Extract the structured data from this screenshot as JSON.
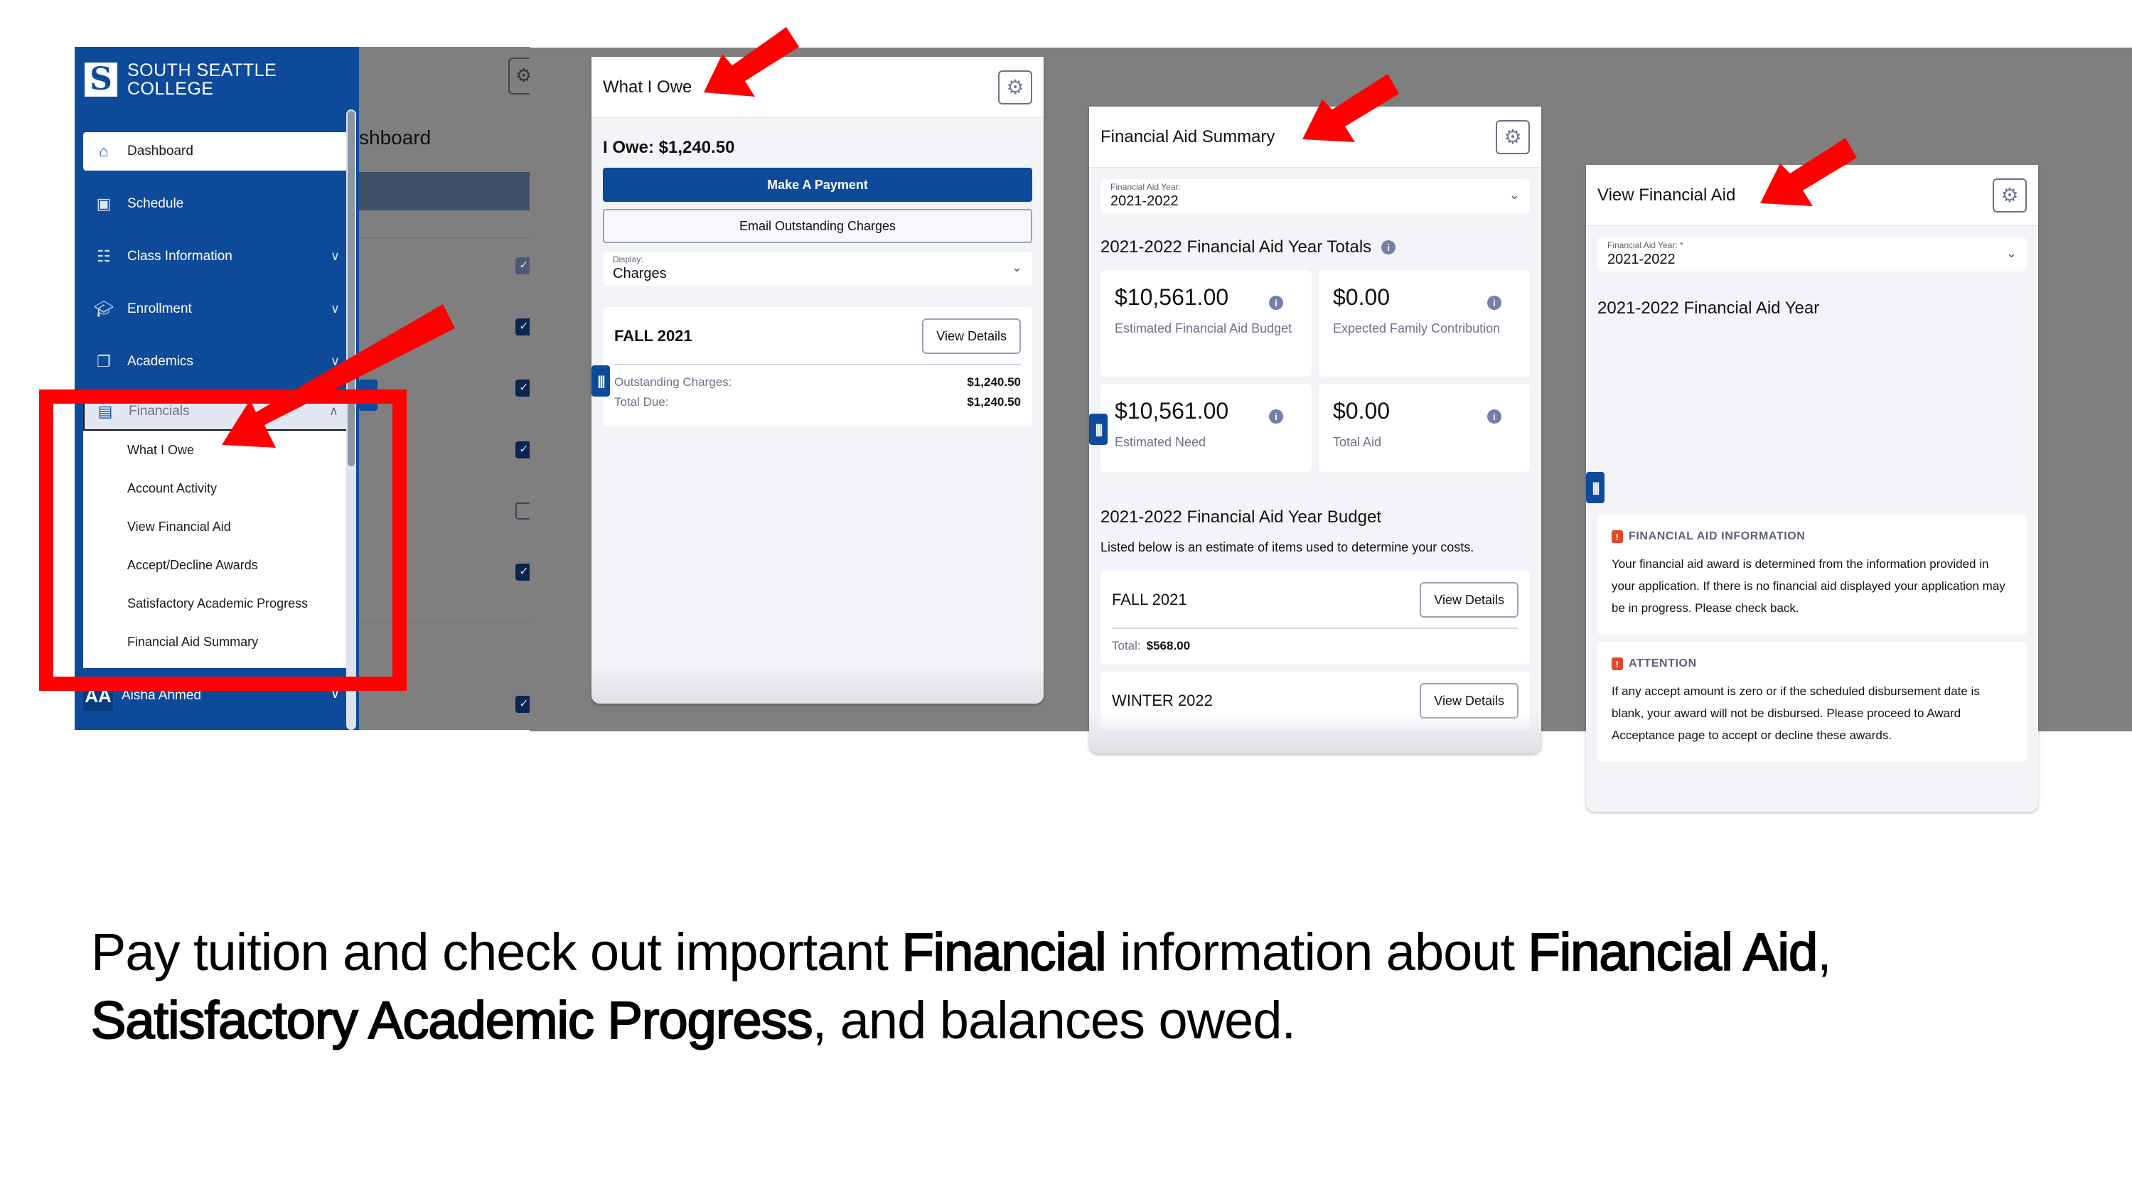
{
  "sidebar": {
    "logo_mark": "S",
    "logo_line1": "SOUTH SEATTLE",
    "logo_line2": "COLLEGE",
    "items": [
      {
        "label": "Dashboard",
        "icon": "home-icon",
        "active": true
      },
      {
        "label": "Schedule",
        "icon": "calendar-icon"
      },
      {
        "label": "Class Information",
        "icon": "list-icon",
        "expandable": true
      },
      {
        "label": "Enrollment",
        "icon": "graduation-cap-icon",
        "expandable": true
      },
      {
        "label": "Academics",
        "icon": "document-icon",
        "expandable": true
      }
    ],
    "financials": {
      "label": "Financials",
      "icon": "credit-card-icon",
      "expanded": true,
      "subitems": [
        "What I Owe",
        "Account Activity",
        "View Financial Aid",
        "Accept/Decline Awards",
        "Satisfactory Academic Progress",
        "Financial Aid Summary"
      ]
    },
    "user": {
      "initials": "AA",
      "name": "Aisha Ahmed"
    }
  },
  "dashboard_bg": {
    "title_fragment": "shboard",
    "checkboxes": [
      "checked-dim",
      "checked",
      "checked",
      "checked",
      "unchecked",
      "checked",
      "checked"
    ]
  },
  "what_i_owe": {
    "title": "What I Owe",
    "owe_label": "I Owe: $1,240.50",
    "make_payment": "Make A Payment",
    "email_charges": "Email Outstanding Charges",
    "display_label": "Display:",
    "display_value": "Charges",
    "term": "FALL 2021",
    "view_details": "View Details",
    "rows": [
      {
        "label": "Outstanding Charges:",
        "value": "$1,240.50"
      },
      {
        "label": "Total Due:",
        "value": "$1,240.50"
      }
    ]
  },
  "fa_summary": {
    "title": "Financial Aid Summary",
    "year_label": "Financial Aid Year:",
    "year_value": "2021-2022",
    "totals_title": "2021-2022 Financial Aid Year Totals",
    "tiles": [
      {
        "amount": "$10,561.00",
        "desc": "Estimated Financial Aid Budget"
      },
      {
        "amount": "$0.00",
        "desc": "Expected Family Contribution"
      },
      {
        "amount": "$10,561.00",
        "desc": "Estimated Need"
      },
      {
        "amount": "$0.00",
        "desc": "Total Aid"
      }
    ],
    "budget_title": "2021-2022 Financial Aid Year Budget",
    "budget_desc": "Listed below is an estimate of items used to determine your costs.",
    "terms": [
      {
        "name": "FALL 2021",
        "total_label": "Total:",
        "total": "$568.00",
        "button": "View Details"
      },
      {
        "name": "WINTER 2022",
        "button": "View Details"
      }
    ]
  },
  "view_fa": {
    "title": "View Financial Aid",
    "year_label": "Financial Aid Year:",
    "required_mark": "*",
    "year_value": "2021-2022",
    "year_heading": "2021-2022 Financial Aid Year",
    "notices": [
      {
        "heading": "FINANCIAL AID INFORMATION",
        "body": "Your financial aid award is determined from the information provided in your application. If there is no financial aid displayed your application may be in progress. Please check back."
      },
      {
        "heading": "ATTENTION",
        "body": "If any accept amount is zero or if the scheduled disbursement date is blank, your award will not be disbursed. Please proceed to Award Acceptance page to accept or decline these awards."
      }
    ]
  },
  "caption": {
    "p1": "Pay tuition and check out important ",
    "b1": "Financial",
    "p2": " information about ",
    "b2": "Financial Aid",
    "p3": ", ",
    "b3": "Satisfactory Academic Progress",
    "p4": ", and balances owed."
  },
  "colors": {
    "brand_blue": "#0e4a9a",
    "annotation_red": "#ff0000",
    "overlay_grey": "#7f7f7f",
    "warning_orange": "#e2492b"
  }
}
